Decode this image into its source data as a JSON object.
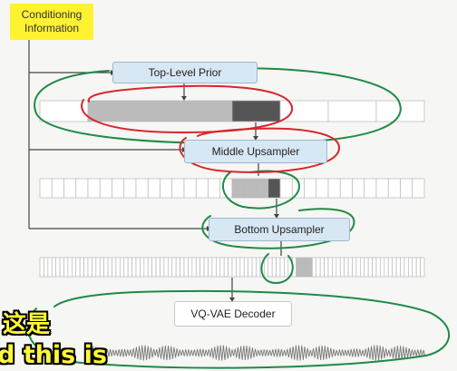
{
  "note": {
    "text": "Conditioning Information"
  },
  "boxes": {
    "prior": "Top-Level Prior",
    "middle": "Middle Upsampler",
    "bottom": "Bottom Upsampler",
    "decoder": "VQ-VAE Decoder"
  },
  "subtitles": {
    "line1": "这是",
    "line2": "d this is"
  },
  "colors": {
    "prior_box": "#d7e7f4",
    "highlight_dark": "#555555",
    "highlight_mid": "#bbbbbb",
    "annotation_green": "#1f8a46",
    "annotation_red": "#d8262e",
    "subtitle": "#fff73a",
    "note": "#fff230"
  }
}
